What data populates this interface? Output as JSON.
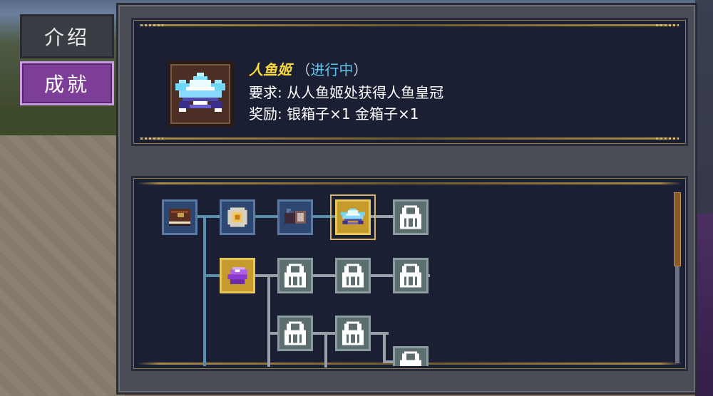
{
  "tabs": [
    {
      "label": "介绍",
      "active": false
    },
    {
      "label": "成就",
      "active": true
    }
  ],
  "achievement": {
    "title": "人鱼姬",
    "status_open": "（",
    "status": "进行中",
    "status_close": "）",
    "requirement_label": "要求:",
    "requirement": "从人鱼姬处获得人鱼皇冠",
    "reward_label": "奖励:",
    "reward_1": "银箱子×1",
    "reward_2": "金箱子×1",
    "icon": "mermaid-crown-icon"
  },
  "colors": {
    "title": "#f7d73a",
    "status": "#5ec8ef",
    "active_tab": "#7d3e97",
    "panel": "#1a1f33",
    "path_done": "#5a8fae",
    "path_locked": "#9aa0a8"
  },
  "tree": {
    "row1": [
      {
        "icon": "book-icon",
        "state": "done"
      },
      {
        "icon": "compass-icon",
        "state": "done"
      },
      {
        "icon": "scroll-icon",
        "state": "done"
      },
      {
        "icon": "mermaid-crown-icon",
        "state": "in-progress"
      },
      {
        "icon": "lock-icon",
        "state": "locked"
      }
    ],
    "row2": [
      {
        "icon": "purple-gem-icon",
        "state": "in-progress"
      },
      {
        "icon": "lock-icon",
        "state": "locked"
      },
      {
        "icon": "lock-icon",
        "state": "locked"
      },
      {
        "icon": "lock-icon",
        "state": "locked"
      }
    ],
    "row3": [
      {
        "icon": "lock-icon",
        "state": "locked"
      },
      {
        "icon": "lock-icon",
        "state": "locked"
      },
      {
        "icon": "lock-icon",
        "state": "locked"
      }
    ]
  }
}
